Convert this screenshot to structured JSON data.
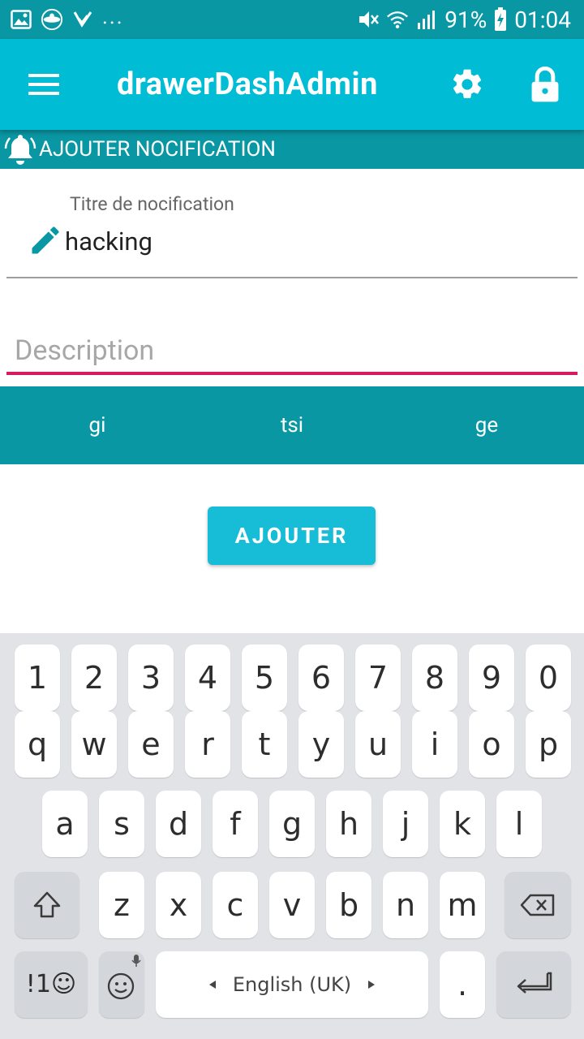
{
  "status_bar": {
    "battery": "91%",
    "time": "01:04",
    "left_icons": [
      "gallery-icon",
      "app-icon",
      "check-icon"
    ],
    "more": "...",
    "right_icons": [
      "mute-icon",
      "wifi-icon",
      "signal-icon",
      "battery-charging-icon"
    ]
  },
  "app_bar": {
    "title": "drawerDashAdmin",
    "icons": [
      "menu-icon",
      "gear-icon",
      "lock-icon"
    ]
  },
  "section": {
    "title": "AJOUTER NOCIFICATION",
    "icon": "bell-icon"
  },
  "form": {
    "title_label": "Titre de nocification",
    "title_value": "hacking",
    "description_placeholder": "Description",
    "accent_color": "#d81b60"
  },
  "tabs": [
    "gi",
    "tsi",
    "ge"
  ],
  "add_button": "AJOUTER",
  "keyboard": {
    "numbers": [
      "1",
      "2",
      "3",
      "4",
      "5",
      "6",
      "7",
      "8",
      "9",
      "0"
    ],
    "row1": [
      "q",
      "w",
      "e",
      "r",
      "t",
      "y",
      "u",
      "i",
      "o",
      "p"
    ],
    "row2": [
      "a",
      "s",
      "d",
      "f",
      "g",
      "h",
      "j",
      "k",
      "l"
    ],
    "row3": [
      "z",
      "x",
      "c",
      "v",
      "b",
      "n",
      "m"
    ],
    "symbols_key": "!1☺",
    "language": "English (UK)",
    "period": "."
  },
  "colors": {
    "status_bar": "#0a97a4",
    "app_bar": "#00bcd4",
    "tabs": "#0a97a4",
    "button": "#17bcd6"
  }
}
